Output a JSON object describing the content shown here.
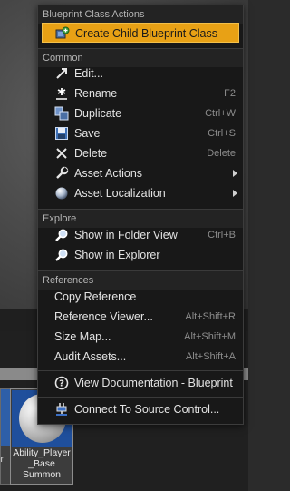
{
  "menu": {
    "sections": {
      "blueprint": "Blueprint Class Actions",
      "common": "Common",
      "explore": "Explore",
      "references": "References"
    },
    "items": {
      "create_child": {
        "label": "Create Child Blueprint Class",
        "icon": "blueprint-add-icon"
      },
      "edit": {
        "label": "Edit...",
        "icon": "edit-arrow-icon"
      },
      "rename": {
        "label": "Rename",
        "shortcut": "F2",
        "icon": "rename-asterisk-icon"
      },
      "duplicate": {
        "label": "Duplicate",
        "shortcut": "Ctrl+W",
        "icon": "duplicate-icon"
      },
      "save": {
        "label": "Save",
        "shortcut": "Ctrl+S",
        "icon": "save-icon"
      },
      "delete": {
        "label": "Delete",
        "shortcut": "Delete",
        "icon": "delete-x-icon"
      },
      "asset_actions": {
        "label": "Asset Actions",
        "icon": "wrench-icon"
      },
      "asset_localization": {
        "label": "Asset Localization",
        "icon": "globe-icon"
      },
      "show_folder": {
        "label": "Show in Folder View",
        "shortcut": "Ctrl+B",
        "icon": "magnifier-icon"
      },
      "show_explorer": {
        "label": "Show in Explorer",
        "icon": "magnifier-icon"
      },
      "copy_reference": {
        "label": "Copy Reference"
      },
      "reference_viewer": {
        "label": "Reference Viewer...",
        "shortcut": "Alt+Shift+R"
      },
      "size_map": {
        "label": "Size Map...",
        "shortcut": "Alt+Shift+M"
      },
      "audit_assets": {
        "label": "Audit Assets...",
        "shortcut": "Alt+Shift+A"
      },
      "view_docs": {
        "label": "View Documentation - Blueprint",
        "icon": "help-circle-icon"
      },
      "source_control": {
        "label": "Connect To Source Control...",
        "icon": "source-control-plug-icon"
      }
    }
  },
  "assets": {
    "left_tile_label": "er",
    "tile_name": "Ability_Player\n_Base\nSummon"
  },
  "colors": {
    "highlight": "#e8a115",
    "menu_bg": "#181818",
    "header_bg": "#232323"
  }
}
